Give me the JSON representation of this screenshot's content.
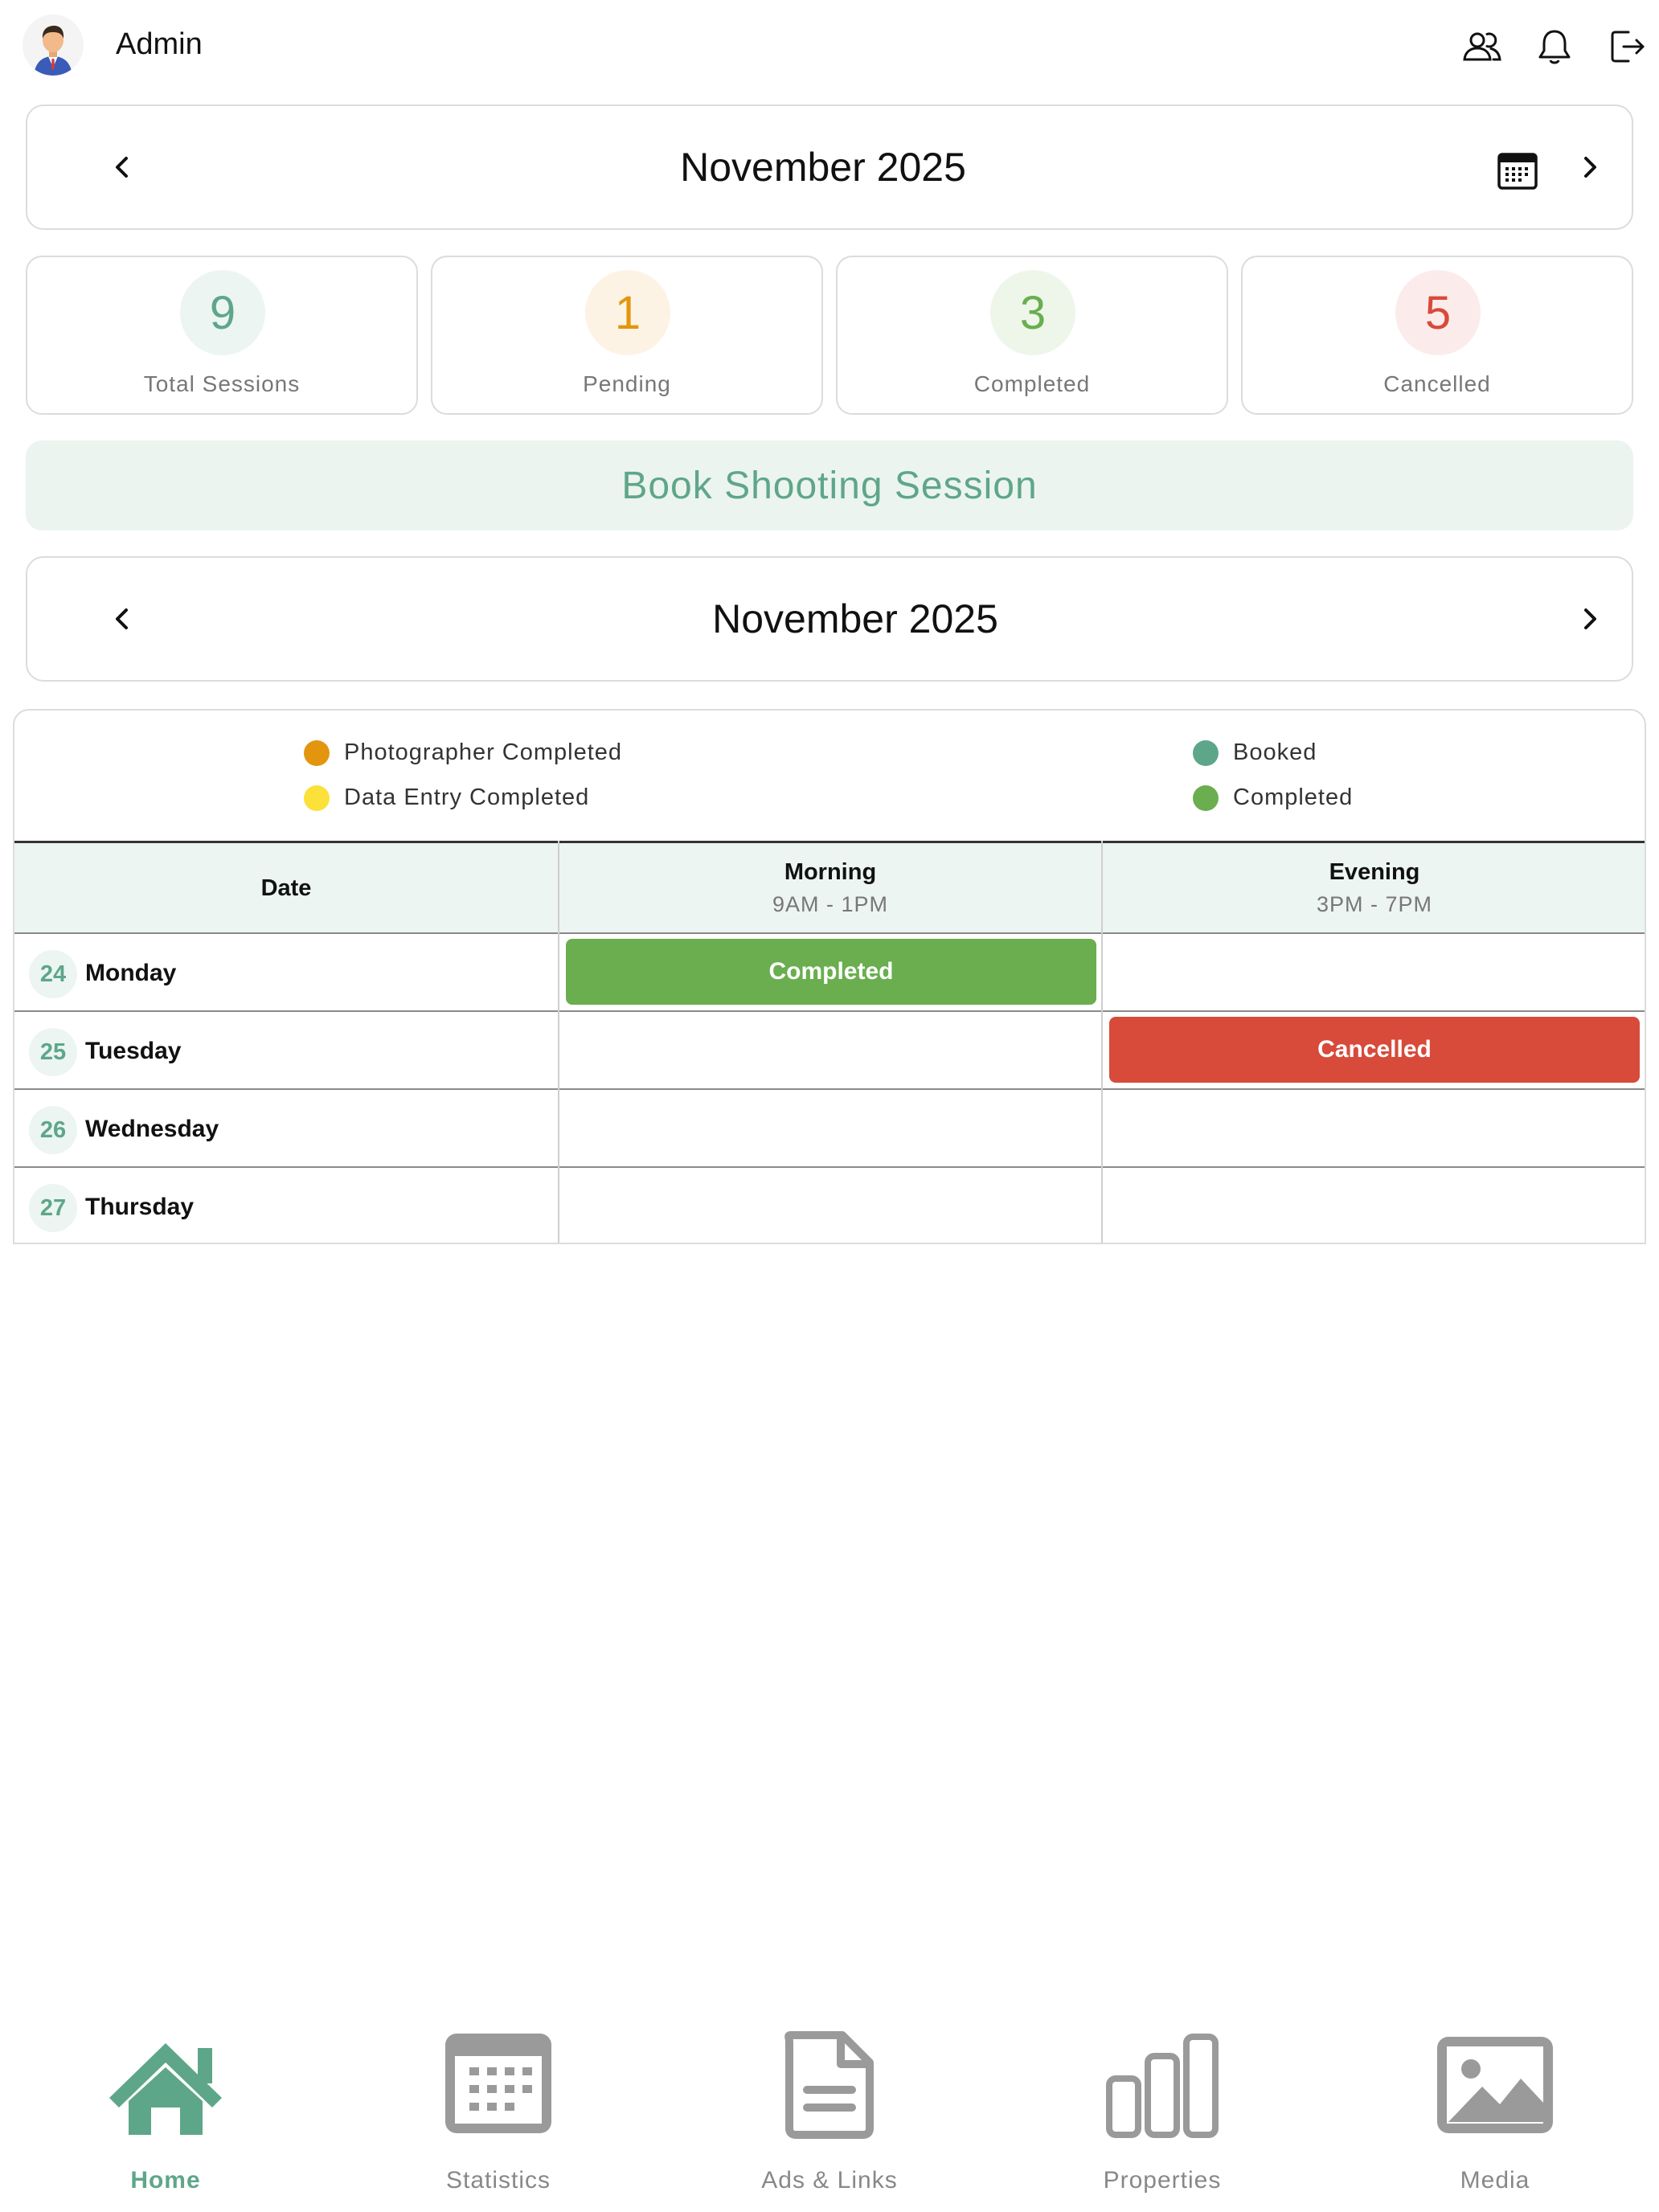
{
  "header": {
    "user_name": "Admin",
    "icons": [
      "avatar",
      "users-icon",
      "bell-icon",
      "logout-icon"
    ]
  },
  "top_month_bar": {
    "title": "November 2025",
    "prev_icon": "chevron-left-icon",
    "next_icon": "chevron-right-icon",
    "calendar_icon": "calendar-icon"
  },
  "stats": [
    {
      "value": "9",
      "label": "Total Sessions",
      "color": "#5ea68a",
      "bg": "#ecf5f2"
    },
    {
      "value": "1",
      "label": "Pending",
      "color": "#e3950e",
      "bg": "#fdf3e4"
    },
    {
      "value": "3",
      "label": "Completed",
      "color": "#6aae4f",
      "bg": "#eef6ea"
    },
    {
      "value": "5",
      "label": "Cancelled",
      "color": "#d84a3a",
      "bg": "#fbeceb"
    }
  ],
  "book_button": {
    "label": "Book Shooting Session"
  },
  "schedule_month_bar": {
    "title": "November 2025"
  },
  "legend": [
    {
      "label": "Photographer Completed",
      "color": "#e3950e"
    },
    {
      "label": "Data Entry Completed",
      "color": "#fbe13a"
    },
    {
      "label": "Booked",
      "color": "#5ea68a"
    },
    {
      "label": "Completed",
      "color": "#6aae4f"
    }
  ],
  "table": {
    "headers": {
      "date": "Date",
      "morning": {
        "title": "Morning",
        "time": "9AM - 1PM"
      },
      "evening": {
        "title": "Evening",
        "time": "3PM - 7PM"
      }
    },
    "rows": [
      {
        "day": "24",
        "name": "Monday",
        "morning": "Completed",
        "evening": ""
      },
      {
        "day": "25",
        "name": "Tuesday",
        "morning": "",
        "evening": "Cancelled"
      },
      {
        "day": "26",
        "name": "Wednesday",
        "morning": "",
        "evening": ""
      },
      {
        "day": "27",
        "name": "Thursday",
        "morning": "",
        "evening": ""
      }
    ]
  },
  "status_colors": {
    "Completed": "#6aae4f",
    "Cancelled": "#d84a3a"
  },
  "bottom_nav": [
    {
      "label": "Home",
      "icon": "home-icon",
      "active": true
    },
    {
      "label": "Statistics",
      "icon": "calendar-grid-icon",
      "active": false
    },
    {
      "label": "Ads & Links",
      "icon": "document-icon",
      "active": false
    },
    {
      "label": "Properties",
      "icon": "bar-chart-icon",
      "active": false
    },
    {
      "label": "Media",
      "icon": "image-icon",
      "active": false
    }
  ]
}
